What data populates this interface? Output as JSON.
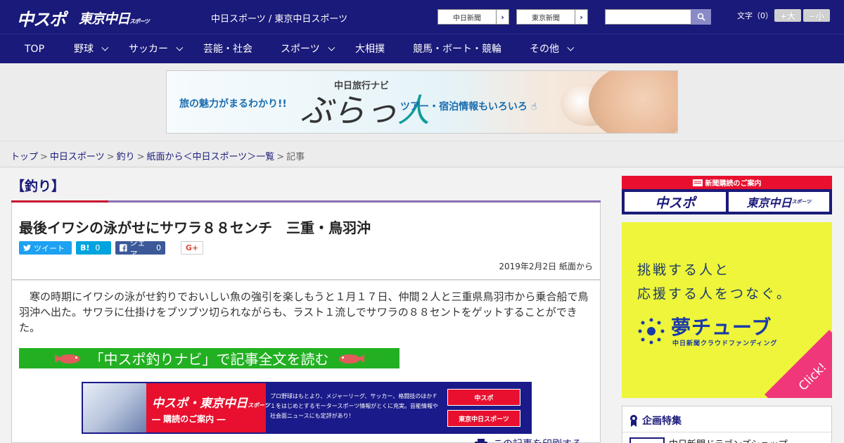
{
  "header": {
    "logo_chunichi_sports": "中スポ",
    "logo_tokyo_chunichi": "東京中日",
    "logo_tokyo_chunichi_suffix": "スポーツ",
    "site_links": "中日スポーツ / 東京中日スポーツ",
    "paper_link_chunichi": "中日新聞",
    "paper_link_tokyo": "東京新聞",
    "search_placeholder": "",
    "font_size_label": "文字（0）",
    "font_larger": "+大",
    "font_smaller": "−小"
  },
  "nav": {
    "items": [
      {
        "label": "TOP",
        "has_dropdown": false
      },
      {
        "label": "野球",
        "has_dropdown": true
      },
      {
        "label": "サッカー",
        "has_dropdown": true
      },
      {
        "label": "芸能・社会",
        "has_dropdown": false
      },
      {
        "label": "スポーツ",
        "has_dropdown": true
      },
      {
        "label": "大相撲",
        "has_dropdown": false
      },
      {
        "label": "競馬・ボート・競輪",
        "has_dropdown": false
      },
      {
        "label": "その他",
        "has_dropdown": true
      }
    ]
  },
  "ad_banner": {
    "left_text": "旅の魅力がまるわかり!!",
    "brand_small": "中日旅行ナビ",
    "brand_big_a": "ぶらっ",
    "brand_big_b": "人",
    "right_text": "ツアー・宿泊情報もいろいろ"
  },
  "breadcrumb": {
    "items": [
      "トップ",
      "中日スポーツ",
      "釣り",
      "紙面から＜中日スポーツ＞一覧"
    ],
    "current": "記事",
    "separator": ">"
  },
  "category": {
    "title": "【釣り】"
  },
  "article": {
    "title": "最後イワシの泳がせにサワラ８８センチ　三重・鳥羽沖",
    "share_tweet": "ツイート",
    "share_hatena_label": "B!",
    "share_hatena_count": "0",
    "share_facebook": "シェア",
    "share_facebook_count": "0",
    "share_google": "G+",
    "date": "2019年2月2日 紙面から",
    "lead": "寒の時期にイワシの泳がせ釣りでおいしい魚の強引を楽しもうと１月１７日、仲間２人と三重県鳥羽市から乗合船で鳥羽沖へ出た。サワラに仕掛けをブツブツ切られながらも、ラスト１流しでサワラの８８セントをゲットすることができた。",
    "navi_button": "「中スポ釣りナビ」で記事全文を読む",
    "print_link": "この記事を印刷する"
  },
  "subscribe_banner": {
    "title": "中スポ・東京中日",
    "title_suffix": "スポーツ",
    "subtitle": "― 購読のご案内 ―",
    "text": "プロ野球はもとより、メジャーリーグ、サッカー、格闘技のほかＦ１をはじめとするモータースポーツ情報がとくに充実。芸能情報や社会面ニュースにも定評があり！",
    "btn_chunichi": "中スポ",
    "btn_tokyo": "東京中日スポーツ"
  },
  "sidebar": {
    "subscribe_header": "新聞購読のご案内",
    "subscribe_chunichi": "中スポ",
    "subscribe_tokyo": "東京中日",
    "subscribe_tokyo_suffix": "スポーツ",
    "yume_line1": "挑戦する人と",
    "yume_line2": "応援する人をつなぐ。",
    "yume_title": "夢チューブ",
    "yume_sub": "中日新聞クラウドファンディング",
    "yume_click": "Click!",
    "kikaku_header": "企画特集",
    "kikaku_item": "中日新聞ドラゴンズショップ"
  },
  "colors": {
    "header_navy": "#1a1a7a",
    "accent_red": "#c8102e",
    "accent_purple": "#8a6fb3",
    "navi_green": "#22b022",
    "yume_yellow": "#eef53a"
  }
}
